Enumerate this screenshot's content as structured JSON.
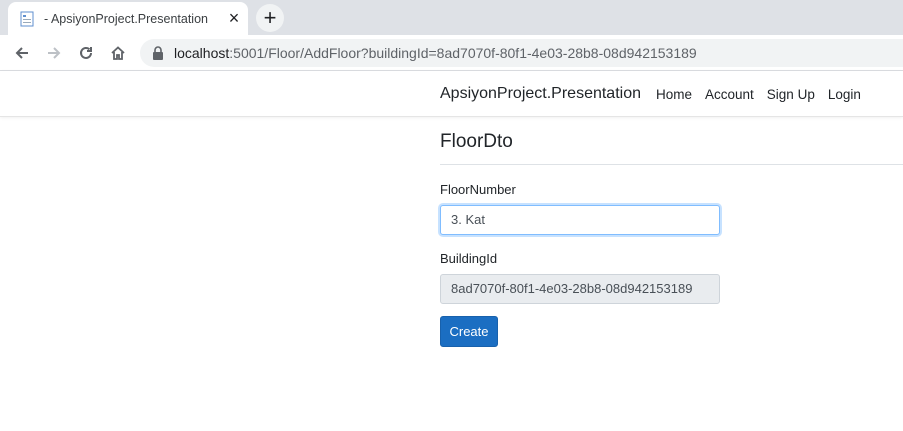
{
  "browser": {
    "tab": {
      "title": "- ApsiyonProject.Presentation",
      "close_icon": "close-icon",
      "favicon_icon": "page-icon"
    },
    "new_tab_icon": "plus-icon",
    "nav": {
      "back_icon": "arrow-left-icon",
      "forward_icon": "arrow-right-icon",
      "reload_icon": "reload-icon",
      "home_icon": "home-icon"
    },
    "address": {
      "lock_icon": "lock-icon",
      "host": "localhost",
      "path": ":5001/Floor/AddFloor?buildingId=8ad7070f-80f1-4e03-28b8-08d942153189"
    }
  },
  "navbar": {
    "brand": "ApsiyonProject.Presentation",
    "links": [
      "Home",
      "Account",
      "Sign Up",
      "Login"
    ]
  },
  "form": {
    "title": "FloorDto",
    "floor_number": {
      "label": "FloorNumber",
      "value": "3. Kat"
    },
    "building_id": {
      "label": "BuildingId",
      "value": "8ad7070f-80f1-4e03-28b8-08d942153189"
    },
    "submit_label": "Create"
  },
  "colors": {
    "primary_button": "#1b6ec2",
    "focus_border": "#80bdff",
    "tabstrip": "#dee1e6"
  }
}
